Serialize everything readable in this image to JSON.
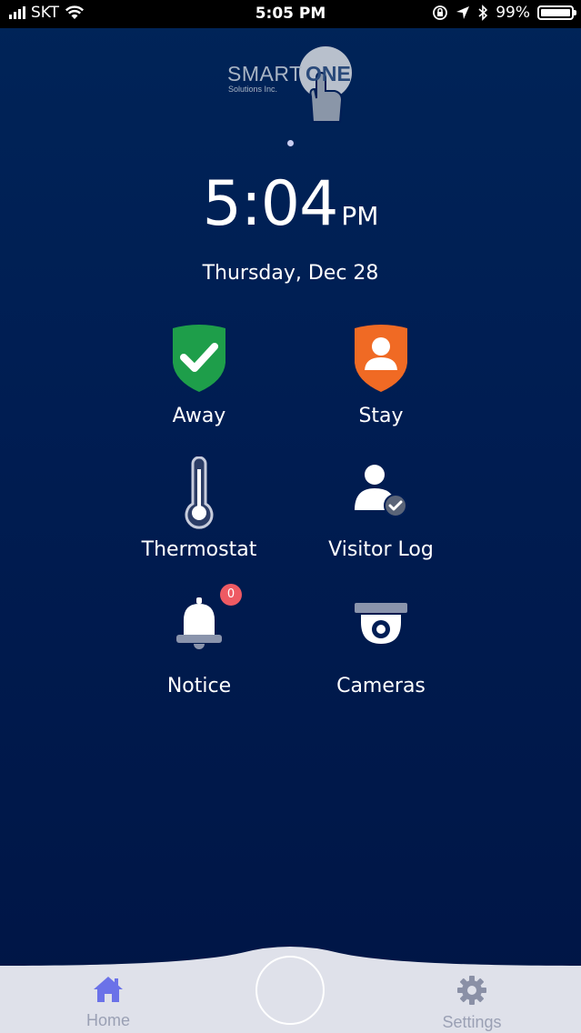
{
  "status_bar": {
    "carrier": "SKT",
    "time": "5:05 PM",
    "battery": "99%",
    "battery_level": 0.99,
    "icons": [
      "signal-icon",
      "wifi-icon",
      "orientation-lock-icon",
      "location-icon",
      "bluetooth-icon",
      "battery-icon"
    ]
  },
  "logo": {
    "smart": "SMART",
    "one": "ONE",
    "sub": "Solutions Inc."
  },
  "clock": {
    "time": "5:04",
    "ampm": "PM",
    "date": "Thursday, Dec 28"
  },
  "tiles": [
    {
      "label": "Away",
      "icon": "shield-check-icon",
      "color": "#1e9e4a"
    },
    {
      "label": "Stay",
      "icon": "shield-user-icon",
      "color": "#f06a24"
    },
    {
      "label": "Thermostat",
      "icon": "thermometer-icon"
    },
    {
      "label": "Visitor Log",
      "icon": "user-check-icon"
    },
    {
      "label": "Notice",
      "icon": "bell-icon",
      "badge": "0"
    },
    {
      "label": "Cameras",
      "icon": "camera-icon"
    }
  ],
  "tabbar": {
    "home": {
      "label": "Home",
      "icon": "home-icon",
      "color": "#6b72e8"
    },
    "settings": {
      "label": "Settings",
      "icon": "gear-icon"
    }
  }
}
